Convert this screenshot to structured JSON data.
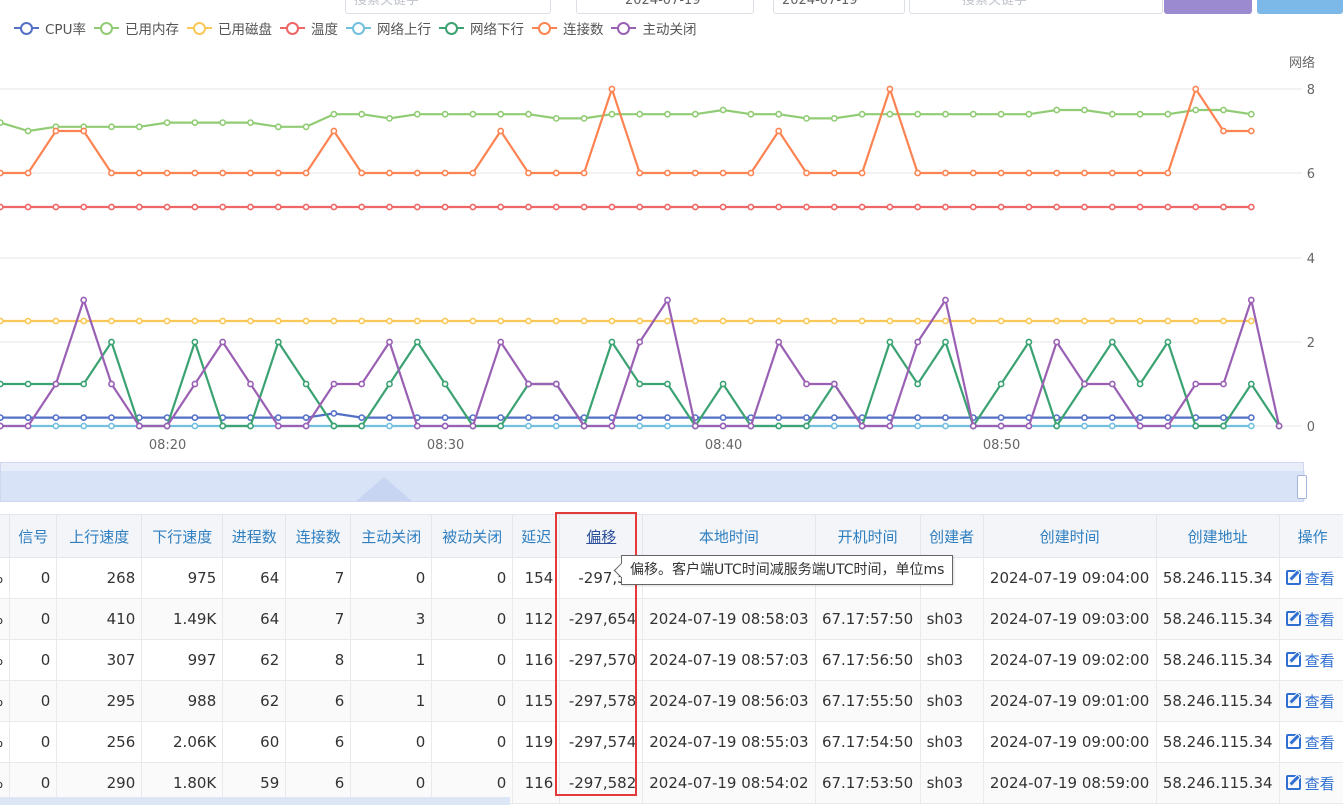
{
  "filters": {
    "keyword_placeholder": "搜索关键字",
    "date_start": "2024-07-19",
    "date_end": "2024-07-19",
    "search_placeholder": "搜索关键字"
  },
  "legend": [
    {
      "name": "CPU率",
      "color": "#5470c6"
    },
    {
      "name": "已用内存",
      "color": "#91cc75"
    },
    {
      "name": "已用磁盘",
      "color": "#fac858"
    },
    {
      "name": "温度",
      "color": "#ee6666"
    },
    {
      "name": "网络上行",
      "color": "#73c0de"
    },
    {
      "name": "网络下行",
      "color": "#3ba272"
    },
    {
      "name": "连接数",
      "color": "#fc8452"
    },
    {
      "name": "主动关闭",
      "color": "#9a60b4"
    }
  ],
  "chart_data": {
    "type": "line",
    "right_axis_label": "网络",
    "y_ticks": [
      0,
      2,
      4,
      6,
      8
    ],
    "ylim": [
      0,
      8
    ],
    "x_tick_labels": [
      {
        "label": "08:20",
        "index": 7
      },
      {
        "label": "08:30",
        "index": 17
      },
      {
        "label": "08:40",
        "index": 27
      },
      {
        "label": "08:50",
        "index": 37
      }
    ],
    "grid": true,
    "legend_position": "top-left",
    "series": [
      {
        "name": "CPU率",
        "color": "#5470c6",
        "values": [
          0.2,
          0.2,
          0.2,
          0.2,
          0.2,
          0.2,
          0.2,
          0.2,
          0.2,
          0.2,
          0.2,
          0.2,
          0.2,
          0.3,
          0.2,
          0.2,
          0.2,
          0.2,
          0.2,
          0.2,
          0.2,
          0.2,
          0.2,
          0.2,
          0.2,
          0.2,
          0.2,
          0.2,
          0.2,
          0.2,
          0.2,
          0.2,
          0.2,
          0.2,
          0.2,
          0.2,
          0.2,
          0.2,
          0.2,
          0.2,
          0.2,
          0.2,
          0.2,
          0.2,
          0.2,
          0.2,
          0.2
        ]
      },
      {
        "name": "已用内存",
        "color": "#91cc75",
        "values": [
          7.2,
          7.2,
          7.0,
          7.1,
          7.1,
          7.1,
          7.1,
          7.2,
          7.2,
          7.2,
          7.2,
          7.1,
          7.1,
          7.4,
          7.4,
          7.3,
          7.4,
          7.4,
          7.4,
          7.4,
          7.4,
          7.3,
          7.3,
          7.4,
          7.4,
          7.4,
          7.4,
          7.5,
          7.4,
          7.4,
          7.3,
          7.3,
          7.4,
          7.4,
          7.4,
          7.4,
          7.4,
          7.4,
          7.4,
          7.5,
          7.5,
          7.4,
          7.4,
          7.4,
          7.5,
          7.5,
          7.4
        ]
      },
      {
        "name": "已用磁盘",
        "color": "#fac858",
        "values": [
          2.5,
          2.5,
          2.5,
          2.5,
          2.5,
          2.5,
          2.5,
          2.5,
          2.5,
          2.5,
          2.5,
          2.5,
          2.5,
          2.5,
          2.5,
          2.5,
          2.5,
          2.5,
          2.5,
          2.5,
          2.5,
          2.5,
          2.5,
          2.5,
          2.5,
          2.5,
          2.5,
          2.5,
          2.5,
          2.5,
          2.5,
          2.5,
          2.5,
          2.5,
          2.5,
          2.5,
          2.5,
          2.5,
          2.5,
          2.5,
          2.5,
          2.5,
          2.5,
          2.5,
          2.5,
          2.5,
          2.5
        ]
      },
      {
        "name": "温度",
        "color": "#ee6666",
        "values": [
          5.2,
          5.2,
          5.2,
          5.2,
          5.2,
          5.2,
          5.2,
          5.2,
          5.2,
          5.2,
          5.2,
          5.2,
          5.2,
          5.2,
          5.2,
          5.2,
          5.2,
          5.2,
          5.2,
          5.2,
          5.2,
          5.2,
          5.2,
          5.2,
          5.2,
          5.2,
          5.2,
          5.2,
          5.2,
          5.2,
          5.2,
          5.2,
          5.2,
          5.2,
          5.2,
          5.2,
          5.2,
          5.2,
          5.2,
          5.2,
          5.2,
          5.2,
          5.2,
          5.2,
          5.2,
          5.2,
          5.2
        ]
      },
      {
        "name": "网络上行",
        "color": "#73c0de",
        "values": [
          0,
          0,
          0,
          0,
          0,
          0,
          0,
          0,
          0,
          0,
          0,
          0,
          0,
          0,
          0,
          0,
          0,
          0,
          0,
          0,
          0,
          0,
          0,
          0,
          0,
          0,
          0,
          0,
          0,
          0,
          0,
          0,
          0,
          0,
          0,
          0,
          0,
          0,
          0,
          0,
          0,
          0,
          0,
          0,
          0,
          0,
          0
        ]
      },
      {
        "name": "网络下行",
        "color": "#3ba272",
        "values": [
          0,
          1,
          1,
          1,
          1,
          2,
          0,
          0,
          2,
          0,
          0,
          2,
          1,
          0,
          0,
          1,
          2,
          1,
          0,
          0,
          1,
          1,
          0,
          2,
          1,
          1,
          0,
          1,
          0,
          0,
          0,
          1,
          0,
          2,
          1,
          2,
          0,
          1,
          2,
          0,
          1,
          2,
          1,
          2,
          0,
          0,
          1,
          0
        ]
      },
      {
        "name": "连接数",
        "color": "#fc8452",
        "values": [
          6,
          6,
          6,
          7,
          7,
          6,
          6,
          6,
          6,
          6,
          6,
          6,
          6,
          7,
          6,
          6,
          6,
          6,
          6,
          7,
          6,
          6,
          6,
          8,
          6,
          6,
          6,
          6,
          6,
          7,
          6,
          6,
          6,
          8,
          6,
          6,
          6,
          6,
          6,
          6,
          6,
          6,
          6,
          6,
          8,
          7,
          7
        ]
      },
      {
        "name": "主动关闭",
        "color": "#9a60b4",
        "values": [
          0,
          0,
          0,
          1,
          3,
          1,
          0,
          0,
          1,
          2,
          1,
          0,
          0,
          1,
          1,
          2,
          0,
          0,
          0,
          2,
          1,
          1,
          0,
          0,
          2,
          3,
          0,
          0,
          0,
          2,
          1,
          1,
          0,
          0,
          2,
          3,
          0,
          0,
          0,
          2,
          1,
          1,
          0,
          0,
          1,
          1,
          3,
          0
        ]
      }
    ]
  },
  "table": {
    "columns": [
      "信号",
      "上行速度",
      "下行速度",
      "进程数",
      "连接数",
      "主动关闭",
      "被动关闭",
      "延迟",
      "偏移",
      "本地时间",
      "开机时间",
      "创建者",
      "创建时间",
      "创建地址",
      "操作"
    ],
    "leading_cell": "%",
    "action_label": "查看",
    "rows": [
      {
        "signal": "0",
        "up": "268",
        "down": "975",
        "proc": "64",
        "conn": "7",
        "active": "0",
        "passive": "0",
        "delay": "154",
        "offset": "-297,57",
        "local": "",
        "boot": "",
        "creator": "",
        "created": "2024-07-19 09:04:00",
        "addr": "58.246.115.34"
      },
      {
        "signal": "0",
        "up": "410",
        "down": "1.49K",
        "proc": "64",
        "conn": "7",
        "active": "3",
        "passive": "0",
        "delay": "112",
        "offset": "-297,654",
        "local": "2024-07-19 08:58:03",
        "boot": "67.17:57:50",
        "creator": "sh03",
        "created": "2024-07-19 09:03:00",
        "addr": "58.246.115.34"
      },
      {
        "signal": "0",
        "up": "307",
        "down": "997",
        "proc": "62",
        "conn": "8",
        "active": "1",
        "passive": "0",
        "delay": "116",
        "offset": "-297,570",
        "local": "2024-07-19 08:57:03",
        "boot": "67.17:56:50",
        "creator": "sh03",
        "created": "2024-07-19 09:02:00",
        "addr": "58.246.115.34"
      },
      {
        "signal": "0",
        "up": "295",
        "down": "988",
        "proc": "62",
        "conn": "6",
        "active": "1",
        "passive": "0",
        "delay": "115",
        "offset": "-297,578",
        "local": "2024-07-19 08:56:03",
        "boot": "67.17:55:50",
        "creator": "sh03",
        "created": "2024-07-19 09:01:00",
        "addr": "58.246.115.34"
      },
      {
        "signal": "0",
        "up": "256",
        "down": "2.06K",
        "proc": "60",
        "conn": "6",
        "active": "0",
        "passive": "0",
        "delay": "119",
        "offset": "-297,574",
        "local": "2024-07-19 08:55:03",
        "boot": "67.17:54:50",
        "creator": "sh03",
        "created": "2024-07-19 09:00:00",
        "addr": "58.246.115.34"
      },
      {
        "signal": "0",
        "up": "290",
        "down": "1.80K",
        "proc": "59",
        "conn": "6",
        "active": "0",
        "passive": "0",
        "delay": "116",
        "offset": "-297,582",
        "local": "2024-07-19 08:54:02",
        "boot": "67.17:53:50",
        "creator": "sh03",
        "created": "2024-07-19 08:59:00",
        "addr": "58.246.115.34"
      }
    ]
  },
  "tooltip": "偏移。客户端UTC时间减服务端UTC时间，单位ms"
}
